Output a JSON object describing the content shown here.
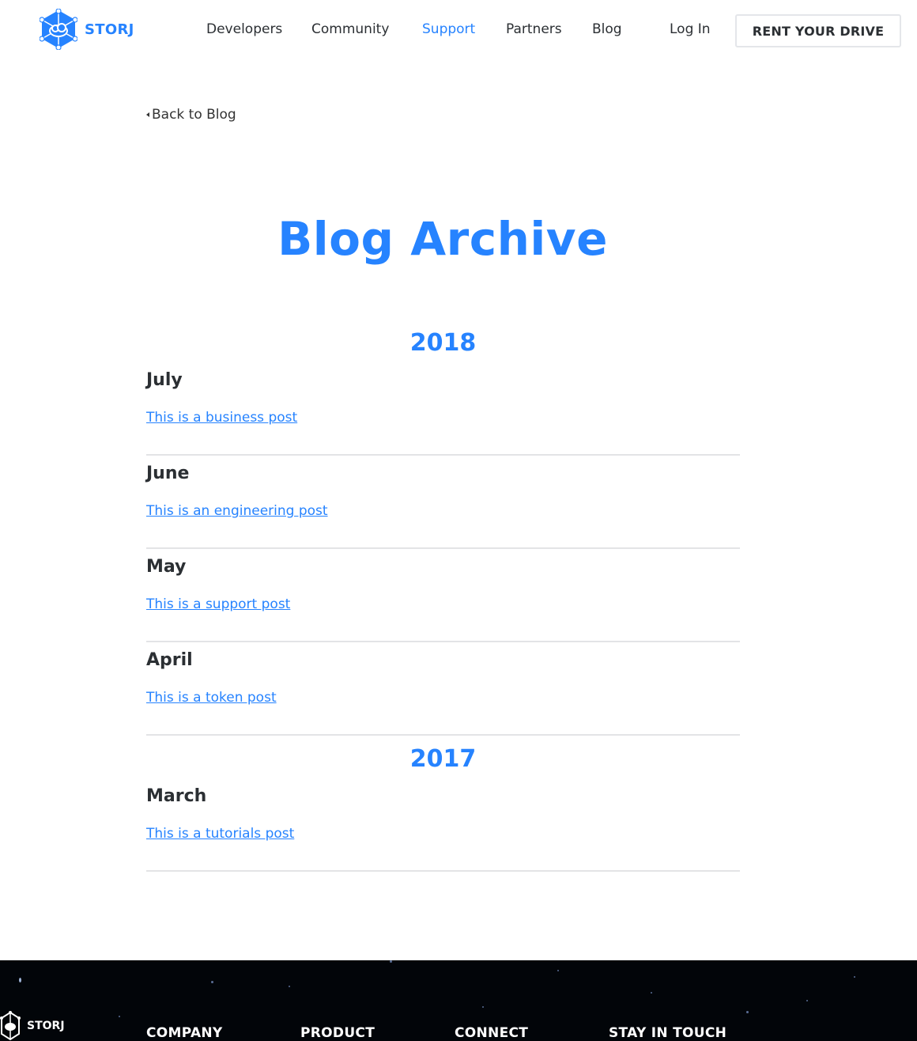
{
  "header": {
    "brand": "STORJ",
    "nav": [
      {
        "label": "Developers",
        "active": false
      },
      {
        "label": "Community",
        "active": false
      },
      {
        "label": "Support",
        "active": true
      },
      {
        "label": "Partners",
        "active": false
      },
      {
        "label": "Blog",
        "active": false
      }
    ],
    "login_label": "Log In",
    "cta_label": "RENT YOUR DRIVE"
  },
  "back_link": "Back to Blog",
  "page_title": "Blog Archive",
  "archive": [
    {
      "year": "2018",
      "months": [
        {
          "month": "July",
          "post": "This is a business post"
        },
        {
          "month": "June",
          "post": "This is an engineering post"
        },
        {
          "month": "May",
          "post": "This is a support post"
        },
        {
          "month": "April",
          "post": "This is a token post"
        }
      ]
    },
    {
      "year": "2017",
      "months": [
        {
          "month": "March",
          "post": "This is a tutorials post"
        }
      ]
    }
  ],
  "footer": {
    "brand": "STORJ",
    "columns": [
      "COMPANY",
      "PRODUCT",
      "CONNECT",
      "STAY IN TOUCH"
    ]
  },
  "colors": {
    "accent": "#2683ff",
    "text": "#2b2f33",
    "footer_bg": "#020509"
  }
}
